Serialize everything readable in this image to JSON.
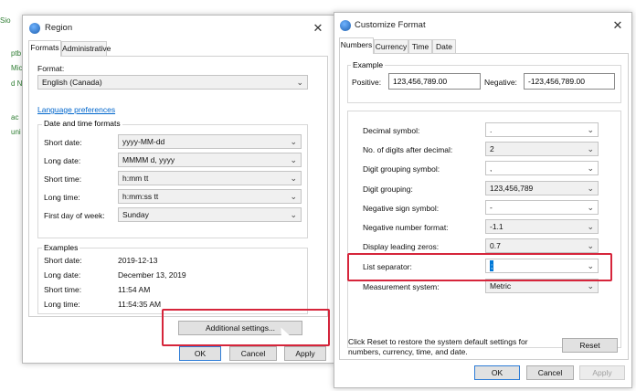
{
  "background": {
    "fragments": [
      "Sio",
      "ptb",
      "Mic",
      "d N",
      "ac",
      "uni"
    ]
  },
  "region": {
    "title": "Region",
    "tabs": [
      "Formats",
      "Administrative"
    ],
    "format_label": "Format:",
    "format_value": "English (Canada)",
    "language_link": "Language preferences",
    "datetime_group": "Date and time formats",
    "rows": [
      {
        "label": "Short date:",
        "value": "yyyy-MM-dd"
      },
      {
        "label": "Long date:",
        "value": "MMMM d, yyyy"
      },
      {
        "label": "Short time:",
        "value": "h:mm tt"
      },
      {
        "label": "Long time:",
        "value": "h:mm:ss tt"
      },
      {
        "label": "First day of week:",
        "value": "Sunday"
      }
    ],
    "examples_group": "Examples",
    "examples": [
      {
        "label": "Short date:",
        "value": "2019-12-13"
      },
      {
        "label": "Long date:",
        "value": "December 13, 2019"
      },
      {
        "label": "Short time:",
        "value": "11:54 AM"
      },
      {
        "label": "Long time:",
        "value": "11:54:35 AM"
      }
    ],
    "additional_button": "Additional settings...",
    "ok": "OK",
    "cancel": "Cancel",
    "apply": "Apply"
  },
  "customize": {
    "title": "Customize Format",
    "tabs": [
      "Numbers",
      "Currency",
      "Time",
      "Date"
    ],
    "example_group": "Example",
    "positive_label": "Positive:",
    "positive_value": "123,456,789.00",
    "negative_label": "Negative:",
    "negative_value": "-123,456,789.00",
    "rows": [
      {
        "label": "Decimal symbol:",
        "value": "."
      },
      {
        "label": "No. of digits after decimal:",
        "value": "2"
      },
      {
        "label": "Digit grouping symbol:",
        "value": ","
      },
      {
        "label": "Digit grouping:",
        "value": "123,456,789"
      },
      {
        "label": "Negative sign symbol:",
        "value": "-"
      },
      {
        "label": "Negative number format:",
        "value": "-1.1"
      },
      {
        "label": "Display leading zeros:",
        "value": "0.7"
      },
      {
        "label": "List separator:",
        "value": ";"
      },
      {
        "label": "Measurement system:",
        "value": "Metric"
      }
    ],
    "reset_text": "Click Reset to restore the system default settings for numbers, currency, time, and date.",
    "reset_button": "Reset",
    "ok": "OK",
    "cancel": "Cancel",
    "apply": "Apply"
  },
  "colors": {
    "highlight": "#d6253b",
    "link": "#0066cc",
    "default_button": "#2d7cd6"
  }
}
